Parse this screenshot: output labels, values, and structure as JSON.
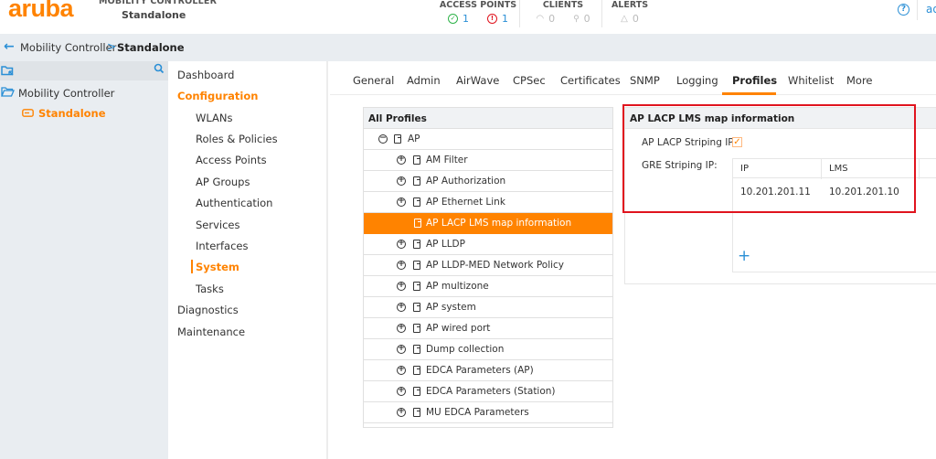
{
  "header": {
    "logo": "aruba",
    "context_label": "MOBILITY CONTROLLER",
    "context_name": "Standalone",
    "stats": {
      "access_points": {
        "title": "ACCESS POINTS",
        "up": "1",
        "down": "1",
        "up_color": "#2fb34a",
        "down_color": "#e0141e"
      },
      "clients": {
        "title": "CLIENTS",
        "wireless": "0",
        "wired": "0"
      },
      "alerts": {
        "title": "ALERTS",
        "count": "0"
      }
    },
    "help_icon": "?",
    "user": "ad"
  },
  "breadcrumb": {
    "back_icon": "←",
    "items": [
      "Mobility Controller",
      "Standalone"
    ],
    "separator": ">"
  },
  "tree": {
    "root": "Mobility Controller",
    "selected": "Standalone"
  },
  "nav": {
    "items": [
      {
        "label": "Dashboard",
        "level": "top"
      },
      {
        "label": "Configuration",
        "level": "top",
        "active": true
      },
      {
        "label": "WLANs",
        "level": "sub"
      },
      {
        "label": "Roles & Policies",
        "level": "sub"
      },
      {
        "label": "Access Points",
        "level": "sub"
      },
      {
        "label": "AP Groups",
        "level": "sub"
      },
      {
        "label": "Authentication",
        "level": "sub"
      },
      {
        "label": "Services",
        "level": "sub"
      },
      {
        "label": "Interfaces",
        "level": "sub"
      },
      {
        "label": "System",
        "level": "sub",
        "active": true
      },
      {
        "label": "Tasks",
        "level": "sub"
      },
      {
        "label": "Diagnostics",
        "level": "top"
      },
      {
        "label": "Maintenance",
        "level": "top"
      }
    ]
  },
  "tabs": {
    "items": [
      "General",
      "Admin",
      "AirWave",
      "CPSec",
      "Certificates",
      "SNMP",
      "Logging",
      "Profiles",
      "Whitelist",
      "More"
    ],
    "active": "Profiles"
  },
  "profiles": {
    "title": "All Profiles",
    "root": "AP",
    "items": [
      "AM Filter",
      "AP Authorization",
      "AP Ethernet Link",
      "AP LACP LMS map information",
      "AP LLDP",
      "AP LLDP-MED Network Policy",
      "AP multizone",
      "AP system",
      "AP wired port",
      "Dump collection",
      "EDCA Parameters (AP)",
      "EDCA Parameters (Station)",
      "MU EDCA Parameters"
    ],
    "selected": "AP LACP LMS map information"
  },
  "detail": {
    "title": "AP LACP LMS map information",
    "lacp_label": "AP LACP Striping IP:",
    "lacp_checked": true,
    "gre_label": "GRE Striping IP:",
    "gre_columns": [
      "IP",
      "LMS"
    ],
    "gre_rows": [
      [
        "10.201.201.11",
        "10.201.201.10"
      ]
    ],
    "add_icon": "+"
  },
  "colors": {
    "accent": "#ff8300",
    "link": "#2a8fd6",
    "highlight_box": "#e0141e"
  }
}
